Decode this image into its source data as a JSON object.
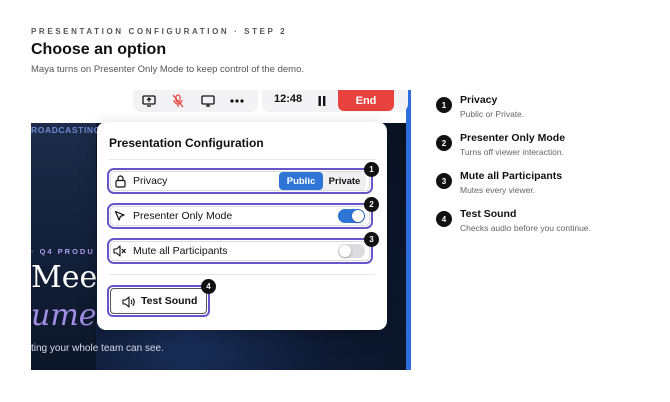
{
  "header": {
    "eyebrow": "PRESENTATION CONFIGURATION · STEP 2",
    "title": "Choose an option",
    "subtitle": "Maya turns on Presenter Only Mode to keep control of the demo."
  },
  "meeting": {
    "clock": "12:48",
    "end_label": "End",
    "broadcasting_text": "ROADCASTING",
    "eyebrow_text": "· Q4 PRODU",
    "headline_line1": "Meet",
    "headline_line2": "umer",
    "tagline": "ting your whole team can see."
  },
  "panel": {
    "title": "Presentation Configuration",
    "privacy_label": "Privacy",
    "privacy_options": [
      "Public",
      "Private"
    ],
    "privacy_selected": "Public",
    "presenter_label": "Presenter Only Mode",
    "presenter_on": true,
    "mute_label": "Mute all Participants",
    "mute_on": false,
    "test_sound_label": "Test Sound"
  },
  "badges": [
    "1",
    "2",
    "3",
    "4"
  ],
  "legend": [
    {
      "num": "1",
      "title": "Privacy",
      "desc": "Public or Private."
    },
    {
      "num": "2",
      "title": "Presenter Only Mode",
      "desc": "Turns off viewer interaction."
    },
    {
      "num": "3",
      "title": "Mute all Participants",
      "desc": "Mutes every viewer."
    },
    {
      "num": "4",
      "title": "Test Sound",
      "desc": "Checks audio before you continue."
    }
  ],
  "colors": {
    "accent": "#2f75d6",
    "outline": "#6656c9",
    "end": "#e8423f",
    "mic_off": "#e8423f"
  }
}
